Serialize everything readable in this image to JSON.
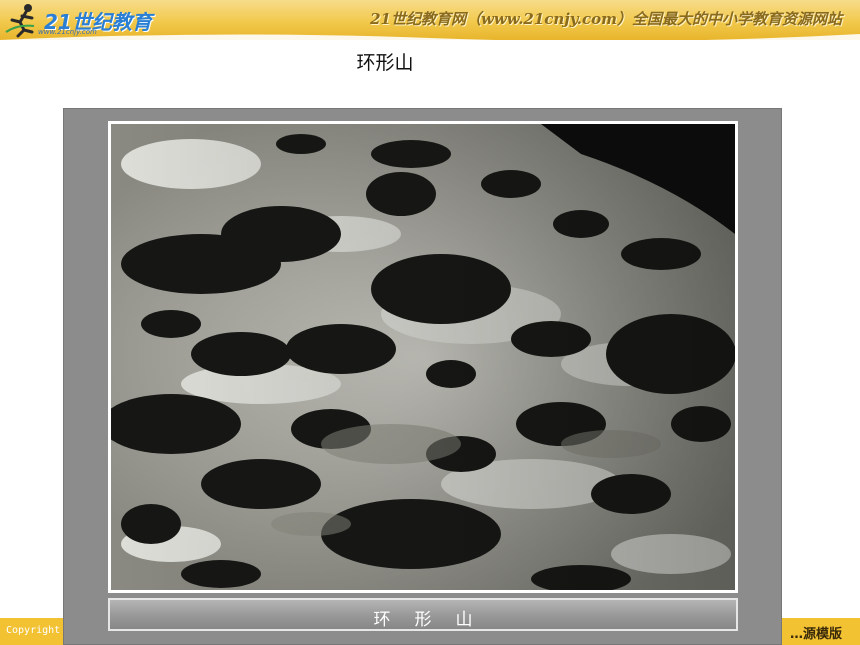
{
  "header": {
    "logo_text": "21世纪教育",
    "logo_url": "www.21cnjy.com",
    "slogan": "21世纪教育网（www.21cnjy.com）全国最大的中小学教育资源网站"
  },
  "page": {
    "title": "环形山"
  },
  "figure": {
    "caption": "环形山",
    "image_description_icon": "moon-crater-photo"
  },
  "footer": {
    "copyright": "Copyright",
    "right_text": "…源模版"
  },
  "colors": {
    "header": "#f2c94c",
    "footer": "#f2c233",
    "frame": "#8c8c8c",
    "caption_bar": "#9a9a9a"
  }
}
